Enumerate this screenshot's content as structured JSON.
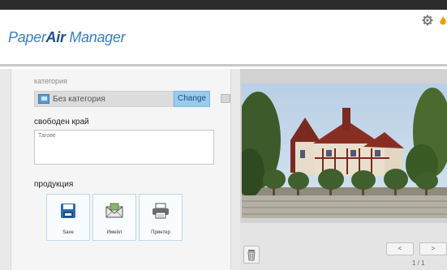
{
  "app": {
    "logo_part1": "Paper",
    "logo_part2": "Air",
    "logo_part3": " Manager",
    "accent": "#3a7fc4",
    "brand_dark": "#1f4f8c",
    "settings_icon": "gear-icon",
    "extra_icon": "flame-icon"
  },
  "category": {
    "label": "категория",
    "value": "Без категория",
    "value_icon": "folder-icon",
    "change_label": "Change",
    "change_color": "#99cbee"
  },
  "free_edge": {
    "label": "свободен край",
    "placeholder": "Тагове"
  },
  "products": {
    "label": "продукция",
    "items": [
      {
        "label": "Save",
        "icon": "floppy-disk-icon"
      },
      {
        "label": "Имейл",
        "icon": "envelope-icon"
      },
      {
        "label": "Принтер",
        "icon": "printer-icon"
      }
    ]
  },
  "preview": {
    "image_icon": "scanned-photo",
    "trash_icon": "trash-icon",
    "prev_label": "<",
    "next_label": ">",
    "page_indicator": "1 / 1"
  }
}
